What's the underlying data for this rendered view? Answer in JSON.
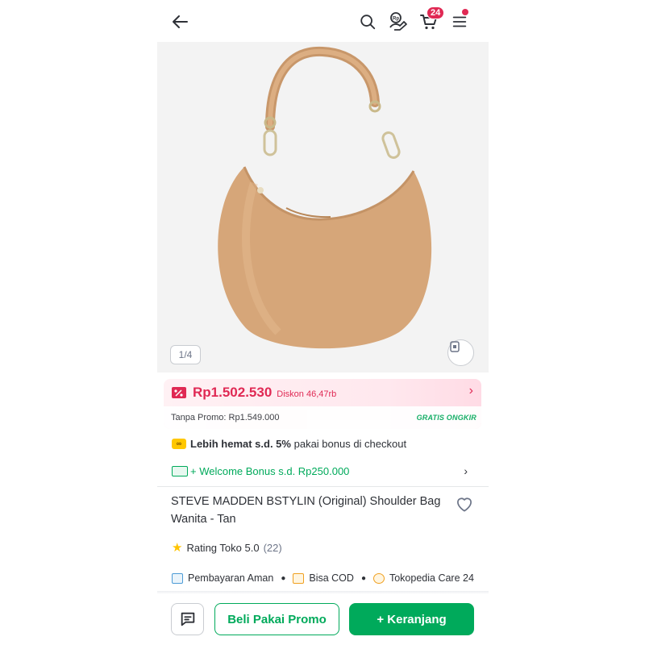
{
  "header": {
    "back_icon": "arrow-left-icon",
    "search_icon": "search-icon",
    "promo_icon": "rp-coupon-icon",
    "cart_icon": "cart-icon",
    "cart_count": "24",
    "menu_icon": "hamburger-menu-icon"
  },
  "gallery": {
    "counter": "1/4",
    "ar_icon": "try-on-icon"
  },
  "price": {
    "current": "Rp1.502.530",
    "discount": "Diskon 46,47rb",
    "without_promo": "Tanpa Promo: Rp1.549.000",
    "shipping": "GRATIS ONGKIR"
  },
  "savings": {
    "badge": "∞",
    "bold": "Lebih hemat s.d. 5%",
    "rest": "pakai bonus di checkout"
  },
  "welcome": {
    "label": "+ Welcome Bonus s.d. Rp250.000"
  },
  "product": {
    "title": "STEVE MADDEN BSTYLIN (Original) Shoulder Bag Wanita - Tan"
  },
  "rating": {
    "label": "Rating Toko 5.0",
    "count": "(22)"
  },
  "badges": {
    "payment": "Pembayaran Aman",
    "cod": "Bisa COD",
    "care": "Tokopedia Care 24"
  },
  "actions": {
    "promo": "Beli Pakai Promo",
    "cart": "+ Keranjang"
  },
  "colors": {
    "accent_green": "#00aa5b",
    "accent_red": "#e02954",
    "bag_tan": "#d6a679"
  }
}
